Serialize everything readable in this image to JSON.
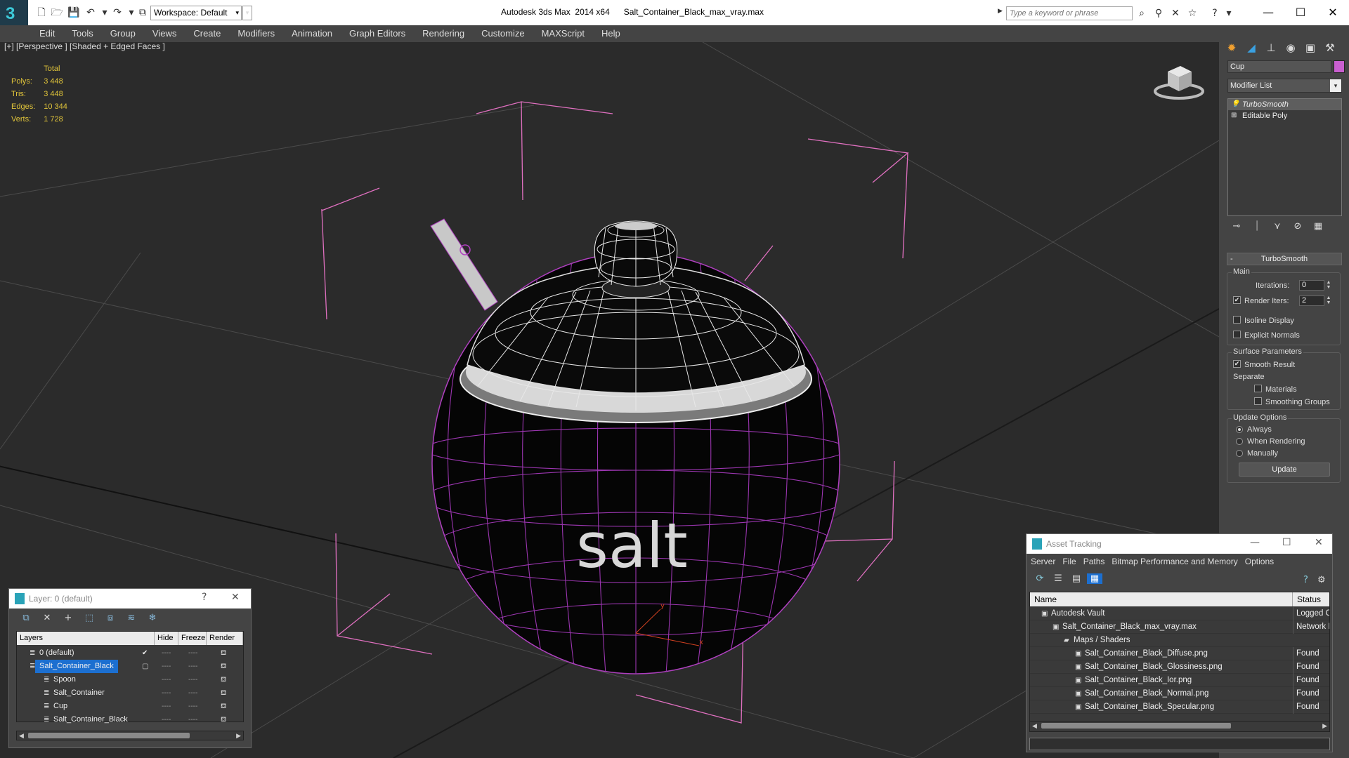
{
  "titlebar": {
    "workspace": "Workspace: Default",
    "title": "Autodesk 3ds Max  2014 x64      Salt_Container_Black_max_vray.max",
    "search_placeholder": "Type a keyword or phrase"
  },
  "menu": [
    "Edit",
    "Tools",
    "Group",
    "Views",
    "Create",
    "Modifiers",
    "Animation",
    "Graph Editors",
    "Rendering",
    "Customize",
    "MAXScript",
    "Help"
  ],
  "viewport": {
    "label": "[+] [Perspective ] [Shaded + Edged Faces ]",
    "stats": {
      "header": "Total",
      "rows": [
        {
          "label": "Polys:",
          "value": "3 448"
        },
        {
          "label": "Tris:",
          "value": "3 448"
        },
        {
          "label": "Edges:",
          "value": "10 344"
        },
        {
          "label": "Verts:",
          "value": "1 728"
        }
      ]
    },
    "text_on_object": "salt",
    "accent_wire": "#b040c0",
    "bracket_color": "#e070c0"
  },
  "command_panel": {
    "object_name": "Cup",
    "object_color": "#c95fcf",
    "modifier_list": "Modifier List",
    "stack": [
      "TurboSmooth",
      "Editable Poly"
    ],
    "turbosmooth": {
      "title": "TurboSmooth",
      "main": "Main",
      "iterations_label": "Iterations:",
      "iterations": "0",
      "render_iters_label": "Render Iters:",
      "render_iters": "2",
      "isoline": "Isoline Display",
      "explicit_normals": "Explicit Normals",
      "surface_params": "Surface Parameters",
      "smooth_result": "Smooth Result",
      "separate": "Separate",
      "materials": "Materials",
      "smoothing_groups": "Smoothing Groups",
      "update_options": "Update Options",
      "always": "Always",
      "when_rendering": "When Rendering",
      "manually": "Manually",
      "update": "Update"
    }
  },
  "layer_dialog": {
    "title": "Layer: 0 (default)",
    "help": "?",
    "columns": [
      "Layers",
      "Hide",
      "Freeze",
      "Render"
    ],
    "rows": [
      {
        "name": "0 (default)",
        "indent": 0
      },
      {
        "name": "Salt_Container_Black",
        "indent": 0,
        "selected": true
      },
      {
        "name": "Spoon",
        "indent": 1
      },
      {
        "name": "Salt_Container",
        "indent": 1
      },
      {
        "name": "Cup",
        "indent": 1
      },
      {
        "name": "Salt_Container_Black",
        "indent": 1
      }
    ]
  },
  "asset_dialog": {
    "title": "Asset Tracking",
    "menu": [
      "Server",
      "File",
      "Paths",
      "Bitmap Performance and Memory",
      "Options"
    ],
    "columns": [
      "Name",
      "Status"
    ],
    "rows": [
      {
        "name": "Autodesk Vault",
        "status": "Logged Out",
        "indent": 1
      },
      {
        "name": "Salt_Container_Black_max_vray.max",
        "status": "Network Path",
        "indent": 2
      },
      {
        "name": "Maps / Shaders",
        "status": "",
        "indent": 3
      },
      {
        "name": "Salt_Container_Black_Diffuse.png",
        "status": "Found",
        "indent": 4
      },
      {
        "name": "Salt_Container_Black_Glossiness.png",
        "status": "Found",
        "indent": 4
      },
      {
        "name": "Salt_Container_Black_Ior.png",
        "status": "Found",
        "indent": 4
      },
      {
        "name": "Salt_Container_Black_Normal.png",
        "status": "Found",
        "indent": 4
      },
      {
        "name": "Salt_Container_Black_Specular.png",
        "status": "Found",
        "indent": 4
      }
    ]
  }
}
